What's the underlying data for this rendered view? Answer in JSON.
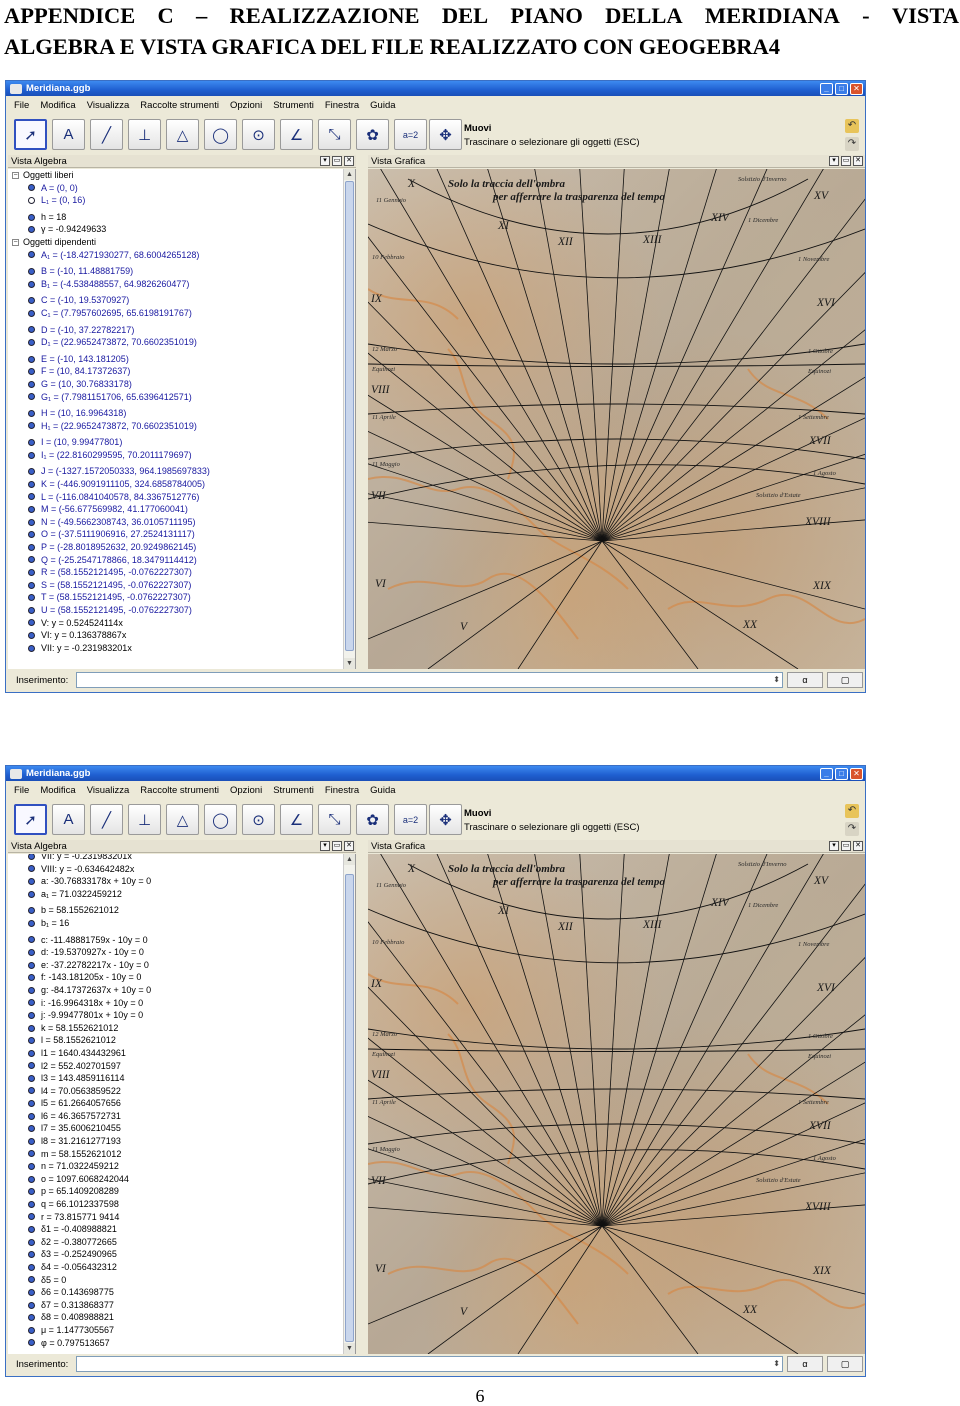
{
  "document": {
    "title_line1": [
      "APPENDICE",
      "C",
      "–",
      "REALIZZAZIONE",
      "DEL",
      "PIANO",
      "DELLA",
      "MERIDIANA",
      "-",
      "VISTA"
    ],
    "title_line2": "ALGEBRA E VISTA GRAFICA DEL FILE REALIZZATO CON GEOGEBRA4",
    "page_number": "6"
  },
  "app": {
    "window_title": "Meridiana.ggb",
    "menu": [
      "File",
      "Modifica",
      "Visualizza",
      "Raccolte strumenti",
      "Opzioni",
      "Strumenti",
      "Finestra",
      "Guida"
    ],
    "tools": [
      {
        "icon": "move-arrow-icon",
        "glyph": "➚"
      },
      {
        "icon": "point-icon",
        "glyph": "A"
      },
      {
        "icon": "line-icon",
        "glyph": "╱"
      },
      {
        "icon": "perpendicular-icon",
        "glyph": "⊥"
      },
      {
        "icon": "polygon-icon",
        "glyph": "△"
      },
      {
        "icon": "circle-icon",
        "glyph": "◯"
      },
      {
        "icon": "ellipse-icon",
        "glyph": "⊙"
      },
      {
        "icon": "angle-icon",
        "glyph": "∠"
      },
      {
        "icon": "reflect-icon",
        "glyph": "⤡"
      },
      {
        "icon": "flower-icon",
        "glyph": "✿"
      },
      {
        "icon": "slider-icon",
        "glyph": "a=2"
      },
      {
        "icon": "move-view-icon",
        "glyph": "✥"
      }
    ],
    "tool_name": "Muovi",
    "tool_help": "Trascinare o selezionare gli oggetti (ESC)",
    "algebra_header": "Vista Algebra",
    "graphics_header": "Vista Grafica",
    "input_label": "Inserimento:",
    "input_value": "",
    "input_keyboard": "α",
    "input_help": "▢"
  },
  "algebra_view_1": [
    {
      "kind": "folder",
      "text": "Oggetti liberi"
    },
    {
      "kind": "item",
      "bullet": "filled",
      "text": "A = (0, 0)"
    },
    {
      "kind": "item",
      "bullet": "empty",
      "text": "L₁ = (0, 16)"
    },
    {
      "kind": "gap",
      "text": ""
    },
    {
      "kind": "item",
      "bullet": "filled",
      "text": "h = 18",
      "style": "black"
    },
    {
      "kind": "item",
      "bullet": "filled",
      "text": "γ = -0.94249633",
      "style": "black"
    },
    {
      "kind": "folder",
      "text": "Oggetti dipendenti"
    },
    {
      "kind": "item",
      "bullet": "filled",
      "text": "A₁ = (-18.4271930277, 68.6004265128)"
    },
    {
      "kind": "gap",
      "text": ""
    },
    {
      "kind": "item",
      "bullet": "filled",
      "text": "B = (-10, 11.48881759)"
    },
    {
      "kind": "item",
      "bullet": "filled",
      "text": "B₁ = (-4.538488557, 64.9826260477)"
    },
    {
      "kind": "gap",
      "text": ""
    },
    {
      "kind": "item",
      "bullet": "filled",
      "text": "C = (-10, 19.5370927)"
    },
    {
      "kind": "item",
      "bullet": "filled",
      "text": "C₁ = (7.7957602695, 65.6198191767)"
    },
    {
      "kind": "gap",
      "text": ""
    },
    {
      "kind": "item",
      "bullet": "filled",
      "text": "D = (-10, 37.22782217)"
    },
    {
      "kind": "item",
      "bullet": "filled",
      "text": "D₁ = (22.9652473872, 70.6602351019)"
    },
    {
      "kind": "gap",
      "text": ""
    },
    {
      "kind": "item",
      "bullet": "filled",
      "text": "E = (-10, 143.181205)"
    },
    {
      "kind": "item",
      "bullet": "filled",
      "text": "F = (10, 84.17372637)"
    },
    {
      "kind": "item",
      "bullet": "filled",
      "text": "G = (10, 30.76833178)"
    },
    {
      "kind": "item",
      "bullet": "filled",
      "text": "G₁ = (7.7981151706, 65.6396412571)"
    },
    {
      "kind": "gap",
      "text": ""
    },
    {
      "kind": "item",
      "bullet": "filled",
      "text": "H = (10, 16.9964318)"
    },
    {
      "kind": "item",
      "bullet": "filled",
      "text": "H₁ = (22.9652473872, 70.6602351019)"
    },
    {
      "kind": "gap",
      "text": ""
    },
    {
      "kind": "item",
      "bullet": "filled",
      "text": "I = (10, 9.99477801)"
    },
    {
      "kind": "item",
      "bullet": "filled",
      "text": "I₁ = (22.8160299595, 70.2011179697)"
    },
    {
      "kind": "gap",
      "text": ""
    },
    {
      "kind": "item",
      "bullet": "filled",
      "text": "J = (-1327.1572050333, 964.1985697833)"
    },
    {
      "kind": "item",
      "bullet": "filled",
      "text": "K = (-446.9091911105, 324.6858784005)"
    },
    {
      "kind": "item",
      "bullet": "filled",
      "text": "L = (-116.0841040578, 84.3367512776)"
    },
    {
      "kind": "item",
      "bullet": "filled",
      "text": "M = (-56.677569982, 41.177060041)"
    },
    {
      "kind": "item",
      "bullet": "filled",
      "text": "N = (-49.5662308743, 36.0105711195)"
    },
    {
      "kind": "item",
      "bullet": "filled",
      "text": "O = (-37.5111906916, 27.2524131117)"
    },
    {
      "kind": "item",
      "bullet": "filled",
      "text": "P = (-28.8018952632, 20.9249862145)"
    },
    {
      "kind": "item",
      "bullet": "filled",
      "text": "Q = (-25.2547178866, 18.3479114412)"
    },
    {
      "kind": "item",
      "bullet": "filled",
      "text": "R = (58.1552121495, -0.0762227307)"
    },
    {
      "kind": "item",
      "bullet": "filled",
      "text": "S = (58.1552121495, -0.0762227307)"
    },
    {
      "kind": "item",
      "bullet": "filled",
      "text": "T = (58.1552121495, -0.0762227307)"
    },
    {
      "kind": "item",
      "bullet": "filled",
      "text": "U = (58.1552121495, -0.0762227307)"
    },
    {
      "kind": "item",
      "bullet": "filled",
      "text": "V: y = 0.524524114x",
      "style": "black"
    },
    {
      "kind": "item",
      "bullet": "filled",
      "text": "VI: y = 0.136378867x",
      "style": "black"
    },
    {
      "kind": "item",
      "bullet": "filled",
      "text": "VII: y = -0.231983201x",
      "style": "black"
    }
  ],
  "algebra_view_2": [
    {
      "kind": "item",
      "bullet": "filled",
      "text": "VII: y = -0.231983201x",
      "style": "black"
    },
    {
      "kind": "item",
      "bullet": "filled",
      "text": "VIII: y = -0.634642482x",
      "style": "black"
    },
    {
      "kind": "item",
      "bullet": "filled",
      "text": "a: -30.76833178x + 10y = 0",
      "style": "black"
    },
    {
      "kind": "item",
      "bullet": "filled",
      "text": "a₁ = 71.0322459212",
      "style": "black"
    },
    {
      "kind": "gap",
      "text": ""
    },
    {
      "kind": "item",
      "bullet": "filled",
      "text": "b = 58.1552621012",
      "style": "black"
    },
    {
      "kind": "item",
      "bullet": "filled",
      "text": "b₁ = 16",
      "style": "black"
    },
    {
      "kind": "gap",
      "text": ""
    },
    {
      "kind": "item",
      "bullet": "filled",
      "text": "c: -11.48881759x - 10y = 0",
      "style": "black"
    },
    {
      "kind": "item",
      "bullet": "filled",
      "text": "d: -19.5370927x - 10y = 0",
      "style": "black"
    },
    {
      "kind": "item",
      "bullet": "filled",
      "text": "e: -37.22782217x - 10y = 0",
      "style": "black"
    },
    {
      "kind": "item",
      "bullet": "filled",
      "text": "f: -143.181205x - 10y = 0",
      "style": "black"
    },
    {
      "kind": "item",
      "bullet": "filled",
      "text": "g: -84.17372637x + 10y = 0",
      "style": "black"
    },
    {
      "kind": "item",
      "bullet": "filled",
      "text": "i: -16.9964318x + 10y = 0",
      "style": "black"
    },
    {
      "kind": "item",
      "bullet": "filled",
      "text": "j: -9.99477801x + 10y = 0",
      "style": "black"
    },
    {
      "kind": "item",
      "bullet": "filled",
      "text": "k = 58.1552621012",
      "style": "black"
    },
    {
      "kind": "item",
      "bullet": "filled",
      "text": "l = 58.1552621012",
      "style": "black"
    },
    {
      "kind": "item",
      "bullet": "filled",
      "text": "l1 = 1640.434432961",
      "style": "black"
    },
    {
      "kind": "item",
      "bullet": "filled",
      "text": "l2 = 552.402701597",
      "style": "black"
    },
    {
      "kind": "item",
      "bullet": "filled",
      "text": "l3 = 143.4859116114",
      "style": "black"
    },
    {
      "kind": "item",
      "bullet": "filled",
      "text": "l4 = 70.0563859522",
      "style": "black"
    },
    {
      "kind": "item",
      "bullet": "filled",
      "text": "l5 = 61.2664057656",
      "style": "black"
    },
    {
      "kind": "item",
      "bullet": "filled",
      "text": "l6 = 46.3657572731",
      "style": "black"
    },
    {
      "kind": "item",
      "bullet": "filled",
      "text": "l7 = 35.6006210455",
      "style": "black"
    },
    {
      "kind": "item",
      "bullet": "filled",
      "text": "l8 = 31.2161277193",
      "style": "black"
    },
    {
      "kind": "item",
      "bullet": "filled",
      "text": "m = 58.1552621012",
      "style": "black"
    },
    {
      "kind": "item",
      "bullet": "filled",
      "text": "n = 71.0322459212",
      "style": "black"
    },
    {
      "kind": "item",
      "bullet": "filled",
      "text": "o = 1097.6068242044",
      "style": "black"
    },
    {
      "kind": "item",
      "bullet": "filled",
      "text": "p = 65.1409208289",
      "style": "black"
    },
    {
      "kind": "item",
      "bullet": "filled",
      "text": "q = 66.1012337598",
      "style": "black"
    },
    {
      "kind": "item",
      "bullet": "filled",
      "text": "r = 73.815771 9414",
      "style": "black"
    },
    {
      "kind": "item",
      "bullet": "filled",
      "text": "δ1 = -0.408988821",
      "style": "black"
    },
    {
      "kind": "item",
      "bullet": "filled",
      "text": "δ2 = -0.380772665",
      "style": "black"
    },
    {
      "kind": "item",
      "bullet": "filled",
      "text": "δ3 = -0.252490965",
      "style": "black"
    },
    {
      "kind": "item",
      "bullet": "filled",
      "text": "δ4 = -0.056432312",
      "style": "black"
    },
    {
      "kind": "item",
      "bullet": "filled",
      "text": "δ5 = 0",
      "style": "black"
    },
    {
      "kind": "item",
      "bullet": "filled",
      "text": "δ6 = 0.143698775",
      "style": "black"
    },
    {
      "kind": "item",
      "bullet": "filled",
      "text": "δ7 = 0.313868377",
      "style": "black"
    },
    {
      "kind": "item",
      "bullet": "filled",
      "text": "δ8 = 0.408988821",
      "style": "black"
    },
    {
      "kind": "item",
      "bullet": "filled",
      "text": "μ = 1.1477305567",
      "style": "black"
    },
    {
      "kind": "item",
      "bullet": "filled",
      "text": "φ = 0.797513657",
      "style": "black"
    }
  ],
  "sundial": {
    "banner_line1": "Solo la traccia dell'ombra",
    "banner_line2": "per afferrare la trasparenza del tempo",
    "hour_labels": [
      "X",
      "XI",
      "XII",
      "XIII",
      "XIV",
      "XV",
      "IX",
      "XVI",
      "VIII",
      "XVII",
      "VII",
      "XVIII",
      "VI",
      "XIX",
      "V",
      "XX"
    ],
    "date_labels_left": [
      "11 Gennaio",
      "10 Febbraio",
      "12 Marzo",
      "Equinozi",
      "11 Aprile",
      "11 Maggio"
    ],
    "date_labels_right": [
      "Solstizio d'Inverno",
      "1 Dicembre",
      "1 Novembre",
      "1 Ottobre",
      "Equinozi",
      "1 Settembre",
      "1 Agosto",
      "Solstizio d'Estate"
    ],
    "colors": {
      "lines": "#111111",
      "stone": "#bfae98",
      "vein": "#d48a4a"
    }
  }
}
